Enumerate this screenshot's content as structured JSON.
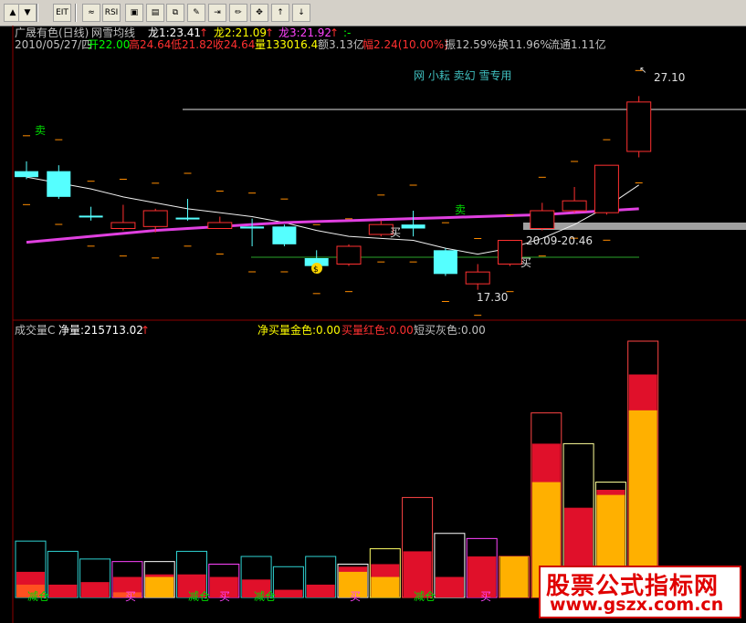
{
  "toolbar": {
    "buttons": [
      {
        "name": "up-arrow-icon",
        "glyph": "▲"
      },
      {
        "name": "down-arrow-icon",
        "glyph": "▼"
      },
      {
        "name": "eit-icon",
        "glyph": "EIT"
      },
      {
        "name": "chart-icon",
        "glyph": "≈"
      },
      {
        "name": "rsi-icon",
        "glyph": "RSI"
      },
      {
        "name": "window-icon",
        "glyph": "▣"
      },
      {
        "name": "table-icon",
        "glyph": "▤"
      },
      {
        "name": "copy-icon",
        "glyph": "⧉"
      },
      {
        "name": "tools-icon",
        "glyph": "✎"
      },
      {
        "name": "export-icon",
        "glyph": "⇥"
      },
      {
        "name": "pen-icon",
        "glyph": "✏"
      },
      {
        "name": "move-cross-icon",
        "glyph": "✥"
      },
      {
        "name": "green-up-arrow-icon",
        "glyph": "↑"
      },
      {
        "name": "green-down-arrow-icon",
        "glyph": "↓"
      }
    ]
  },
  "header": {
    "stock_name": "广晟有色(日线)",
    "indicator": "网雪均线",
    "long1": "龙1:23.41",
    "long2": "龙2:21.09",
    "long3": "龙3:21.92",
    "tail": ":-",
    "date": "2010/05/27/四",
    "open": "开22.00",
    "high": "高24.64",
    "low": "低21.82",
    "close": "收24.64",
    "volume": "量133016.4",
    "amount": "额3.13亿",
    "change": "幅2.24(10.00%)",
    "amplitude": "振12.59%",
    "turnover": "换11.96%",
    "float": "流通1.11亿"
  },
  "price_chart": {
    "annotation_title": "网 小耘 卖幻 雪专用",
    "label_sell1": "卖",
    "label_sell2": "卖",
    "label_buy1": "买",
    "label_buy2": "买",
    "high_label": "27.10",
    "low_label": "17.30",
    "range_label": "20.09-20.46",
    "price_min": 16.5,
    "price_max": 28.5,
    "candles": [
      {
        "o": 23.0,
        "c": 23.3,
        "h": 23.8,
        "l": 22.9,
        "color": "cyan"
      },
      {
        "o": 23.3,
        "c": 22.0,
        "h": 23.6,
        "l": 21.9,
        "color": "cyan"
      },
      {
        "o": 21.0,
        "c": 21.05,
        "h": 21.5,
        "l": 20.8,
        "color": "cyan"
      },
      {
        "o": 20.4,
        "c": 20.7,
        "h": 21.6,
        "l": 20.3,
        "color": "red"
      },
      {
        "o": 20.5,
        "c": 21.3,
        "h": 21.4,
        "l": 20.2,
        "color": "red"
      },
      {
        "o": 20.9,
        "c": 20.95,
        "h": 21.9,
        "l": 20.8,
        "color": "cyan"
      },
      {
        "o": 20.4,
        "c": 20.7,
        "h": 21.0,
        "l": 20.4,
        "color": "red"
      },
      {
        "o": 20.5,
        "c": 20.4,
        "h": 20.9,
        "l": 19.5,
        "color": "cyan"
      },
      {
        "o": 20.5,
        "c": 19.6,
        "h": 20.6,
        "l": 19.5,
        "color": "cyan"
      },
      {
        "o": 18.9,
        "c": 18.5,
        "h": 19.3,
        "l": 18.4,
        "color": "cyan"
      },
      {
        "o": 18.6,
        "c": 19.5,
        "h": 19.6,
        "l": 18.5,
        "color": "red"
      },
      {
        "o": 20.1,
        "c": 20.6,
        "h": 20.8,
        "l": 20.0,
        "color": "red"
      },
      {
        "o": 20.6,
        "c": 20.4,
        "h": 21.3,
        "l": 20.0,
        "color": "cyan"
      },
      {
        "o": 19.3,
        "c": 18.1,
        "h": 19.4,
        "l": 18.0,
        "color": "cyan"
      },
      {
        "o": 17.6,
        "c": 18.2,
        "h": 18.6,
        "l": 17.3,
        "color": "red"
      },
      {
        "o": 18.6,
        "c": 19.8,
        "h": 19.8,
        "l": 18.5,
        "color": "red"
      },
      {
        "o": 20.4,
        "c": 21.3,
        "h": 21.7,
        "l": 20.3,
        "color": "red"
      },
      {
        "o": 21.3,
        "c": 21.8,
        "h": 22.5,
        "l": 21.2,
        "color": "red"
      },
      {
        "o": 21.2,
        "c": 23.6,
        "h": 23.6,
        "l": 21.1,
        "color": "red"
      },
      {
        "o": 24.3,
        "c": 26.8,
        "h": 27.1,
        "l": 24.0,
        "color": "red"
      }
    ],
    "white_ma": [
      23.0,
      22.7,
      22.4,
      22.0,
      21.7,
      21.4,
      21.2,
      21.0,
      20.7,
      20.3,
      20.0,
      19.9,
      19.8,
      19.4,
      19.1,
      19.4,
      19.9,
      20.6,
      21.5,
      22.6
    ],
    "purple_ma": [
      19.7,
      19.85,
      20.0,
      20.15,
      20.3,
      20.4,
      20.5,
      20.6,
      20.7,
      20.75,
      20.8,
      20.85,
      20.9,
      20.95,
      21.0,
      21.05,
      21.1,
      21.2,
      21.3,
      21.4
    ]
  },
  "volume_panel": {
    "title": "成交量C",
    "net_label": "净量:215713.02",
    "net_buy_gold": "净买量金色:0.00",
    "buy_red": "买量红色:0.00",
    "short_buy_gray": "短买灰色:0.00",
    "label_reduce1": "减仓",
    "label_reduce2": "减仓",
    "label_reduce3": "减仓",
    "label_reduce4": "减仓",
    "label_buy1": "买",
    "label_buy2": "买",
    "label_buy3": "买",
    "label_buy4": "买",
    "bars": [
      {
        "total": 0.22,
        "inner": 0.1,
        "core": 0.05,
        "outline": "#2fd2d2",
        "fill": "red"
      },
      {
        "total": 0.18,
        "inner": 0.05,
        "core": 0.0,
        "outline": "#2fd2d2",
        "fill": "red"
      },
      {
        "total": 0.15,
        "inner": 0.06,
        "core": 0.0,
        "outline": "#2fd2d2",
        "fill": "red"
      },
      {
        "total": 0.14,
        "inner": 0.08,
        "core": 0.02,
        "outline": "#ff44ff",
        "fill": "red"
      },
      {
        "total": 0.14,
        "inner": 0.09,
        "core": 0.08,
        "outline": "#ffffff",
        "fill": "gold"
      },
      {
        "total": 0.18,
        "inner": 0.09,
        "core": 0.0,
        "outline": "#2fd2d2",
        "fill": "red"
      },
      {
        "total": 0.13,
        "inner": 0.08,
        "core": 0.0,
        "outline": "#ff44ff",
        "fill": "red"
      },
      {
        "total": 0.16,
        "inner": 0.07,
        "core": 0.0,
        "outline": "#2fd2d2",
        "fill": "red"
      },
      {
        "total": 0.12,
        "inner": 0.03,
        "core": 0.0,
        "outline": "#2fd2d2",
        "fill": "red"
      },
      {
        "total": 0.16,
        "inner": 0.05,
        "core": 0.0,
        "outline": "#2fd2d2",
        "fill": "red"
      },
      {
        "total": 0.13,
        "inner": 0.12,
        "core": 0.1,
        "outline": "#ffffff",
        "fill": "gold"
      },
      {
        "total": 0.19,
        "inner": 0.13,
        "core": 0.08,
        "outline": "#ffff66",
        "fill": "gold"
      },
      {
        "total": 0.39,
        "inner": 0.18,
        "core": 0.0,
        "outline": "#ff4444",
        "fill": "red"
      },
      {
        "total": 0.25,
        "inner": 0.08,
        "core": 0.0,
        "outline": "#ffffff",
        "fill": "red"
      },
      {
        "total": 0.23,
        "inner": 0.16,
        "core": 0.0,
        "outline": "#ff44ff",
        "fill": "red"
      },
      {
        "total": 0.16,
        "inner": 0.16,
        "core": 0.16,
        "outline": "#ff4444",
        "fill": "gold"
      },
      {
        "total": 0.72,
        "inner": 0.6,
        "core": 0.45,
        "outline": "#ff4444",
        "fill": "gold"
      },
      {
        "total": 0.6,
        "inner": 0.35,
        "core": 0.0,
        "outline": "#ffff99",
        "fill": "red"
      },
      {
        "total": 0.45,
        "inner": 0.42,
        "core": 0.4,
        "outline": "#ffff99",
        "fill": "gold"
      },
      {
        "total": 1.0,
        "inner": 0.87,
        "core": 0.73,
        "outline": "#ff4444",
        "fill": "gold"
      }
    ]
  },
  "watermark": {
    "line1": "股票公式指标网",
    "line2": "www.gszx.com.cn"
  }
}
